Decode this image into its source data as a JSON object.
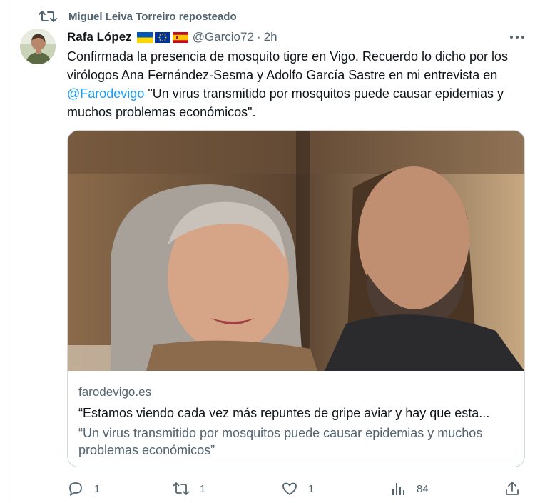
{
  "repost": {
    "label": "Miguel Leiva Torreiro reposteado",
    "icon": "repost-icon"
  },
  "author": {
    "name": "Rafa López",
    "flags": [
      "ukraine-flag",
      "eu-flag",
      "spain-flag"
    ],
    "handle": "@Garcio72",
    "separator": "·",
    "time": "2h"
  },
  "tweet": {
    "text_before": "Confirmada la presencia de mosquito tigre en Vigo. Recuerdo lo dicho por los virólogos Ana Fernández-Sesma y Adolfo García Sastre en mi entrevista en ",
    "mention": "@Farodevigo",
    "text_after": " \"Un virus transmitido por mosquitos puede causar epidemias y muchos problemas económicos\"."
  },
  "card": {
    "domain": "farodevigo.es",
    "headline": "“Estamos viendo cada vez más repuntes de gripe aviar y hay que esta...",
    "description": "“Un virus transmitido por mosquitos puede causar epidemias y muchos problemas económicos”"
  },
  "actions": {
    "replies": "1",
    "reposts": "1",
    "likes": "1",
    "views": "84"
  },
  "colors": {
    "accent": "#1d9bf0",
    "secondary_text": "#536471",
    "border": "#cfd9de"
  }
}
